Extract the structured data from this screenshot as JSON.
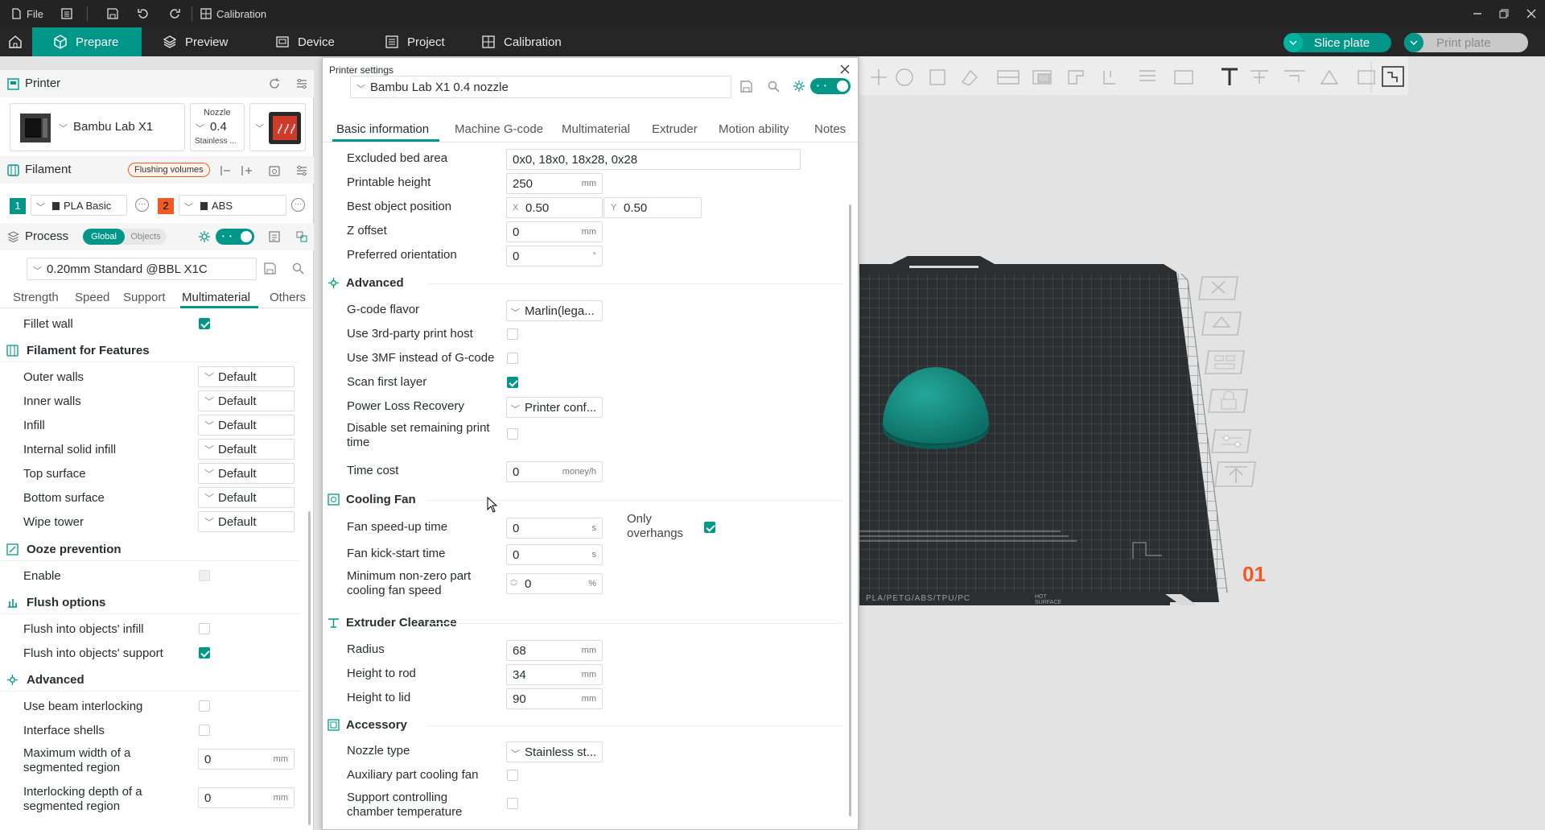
{
  "titlebar": {
    "file_label": "File",
    "window_title": "Calibration",
    "icons": [
      "file-icon",
      "menu-list-icon",
      "save-icon",
      "undo-icon",
      "redo-icon",
      "calibration-icon",
      "minimize-icon",
      "restore-icon",
      "close-icon"
    ]
  },
  "menubar": {
    "tabs": [
      {
        "label": "Prepare",
        "icon": "cube-icon",
        "active": true
      },
      {
        "label": "Preview",
        "icon": "layers-icon"
      },
      {
        "label": "Device",
        "icon": "device-icon"
      },
      {
        "label": "Project",
        "icon": "project-icon"
      },
      {
        "label": "Calibration",
        "icon": "calibration-icon"
      }
    ],
    "slice_label": "Slice plate",
    "print_label": "Print plate"
  },
  "left": {
    "printer": {
      "title": "Printer",
      "name": "Bambu Lab X1",
      "nozzle_label": "Nozzle",
      "nozzle_value": "0.4",
      "nozzle_material": "Stainless ..."
    },
    "filament": {
      "title": "Filament",
      "flushing_label": "Flushing volumes",
      "items": [
        {
          "index": "1",
          "name": "PLA Basic",
          "color": "#009688"
        },
        {
          "index": "2",
          "name": "ABS",
          "color": "#f05a23"
        }
      ]
    },
    "process": {
      "title": "Process",
      "global_label": "Global",
      "objects_label": "Objects",
      "preset": "0.20mm Standard @BBL X1C",
      "tabs": [
        "Strength",
        "Speed",
        "Support",
        "Multimaterial",
        "Others"
      ],
      "active_tab": "Multimaterial"
    },
    "settings": {
      "fillet_wall": "Fillet wall",
      "filament_features": {
        "title": "Filament for Features",
        "rows": [
          {
            "label": "Outer walls",
            "value": "Default"
          },
          {
            "label": "Inner walls",
            "value": "Default"
          },
          {
            "label": "Infill",
            "value": "Default"
          },
          {
            "label": "Internal solid infill",
            "value": "Default"
          },
          {
            "label": "Top surface",
            "value": "Default"
          },
          {
            "label": "Bottom surface",
            "value": "Default"
          },
          {
            "label": "Wipe tower",
            "value": "Default"
          }
        ]
      },
      "ooze": {
        "title": "Ooze prevention",
        "enable": "Enable"
      },
      "flush": {
        "title": "Flush options",
        "infill": "Flush into objects' infill",
        "support": "Flush into objects' support"
      },
      "advanced": {
        "title": "Advanced",
        "beam": "Use beam interlocking",
        "shells": "Interface shells",
        "max_width_1": "Maximum width of a",
        "max_width_2": "segmented region",
        "max_width_value": "0",
        "depth_1": "Interlocking depth of a",
        "depth_2": "segmented region",
        "depth_value": "0",
        "unit": "mm"
      }
    }
  },
  "dialog": {
    "title": "Printer settings",
    "preset": "Bambu Lab X1 0.4 nozzle",
    "tabs": [
      "Basic information",
      "Machine G-code",
      "Multimaterial",
      "Extruder",
      "Motion ability",
      "Notes"
    ],
    "active_tab": "Basic information",
    "basic": {
      "excluded_bed_area": {
        "label": "Excluded bed area",
        "value": "0x0, 18x0, 18x28, 0x28"
      },
      "printable_height": {
        "label": "Printable height",
        "value": "250",
        "unit": "mm"
      },
      "best_object_position": {
        "label": "Best object position",
        "x_label": "X",
        "x": "0.50",
        "y_label": "Y",
        "y": "0.50"
      },
      "z_offset": {
        "label": "Z offset",
        "value": "0",
        "unit": "mm"
      },
      "preferred_orientation": {
        "label": "Preferred orientation",
        "value": "0",
        "unit": "°"
      }
    },
    "advanced": {
      "title": "Advanced",
      "gcode_flavor": {
        "label": "G-code flavor",
        "value": "Marlin(lega..."
      },
      "third_party": "Use 3rd-party print host",
      "use_3mf": "Use 3MF instead of G-code",
      "scan_first_layer": "Scan first layer",
      "power_loss": {
        "label": "Power Loss Recovery",
        "value": "Printer conf..."
      },
      "disable_remaining_1": "Disable set remaining print",
      "disable_remaining_2": "time",
      "time_cost": {
        "label": "Time cost",
        "value": "0",
        "unit": "money/h"
      }
    },
    "cooling": {
      "title": "Cooling Fan",
      "speedup": {
        "label": "Fan speed-up time",
        "value": "0",
        "unit": "s"
      },
      "only_overhangs_1": "Only",
      "only_overhangs_2": "overhangs",
      "kickstart": {
        "label": "Fan kick-start time",
        "value": "0",
        "unit": "s"
      },
      "min_speed_1": "Minimum non-zero part",
      "min_speed_2": "cooling fan speed",
      "min_speed_value": "0",
      "min_speed_unit": "%"
    },
    "clearance": {
      "title": "Extruder Clearance",
      "radius": {
        "label": "Radius",
        "value": "68",
        "unit": "mm"
      },
      "height_rod": {
        "label": "Height to rod",
        "value": "34",
        "unit": "mm"
      },
      "height_lid": {
        "label": "Height to lid",
        "value": "90",
        "unit": "mm"
      }
    },
    "accessory": {
      "title": "Accessory",
      "nozzle_type": {
        "label": "Nozzle type",
        "value": "Stainless st..."
      },
      "aux_fan": "Auxiliary part cooling fan",
      "chamber_1": "Support controlling",
      "chamber_2": "chamber temperature"
    }
  },
  "viewport": {
    "plate_number": "01",
    "plate_label": "PLA/PETG/ABS/TPU/PC",
    "hot_surface": "HOT SURFACE"
  },
  "colors": {
    "accent": "#009688",
    "filament_2": "#f05a23",
    "model": "#0f857a",
    "plate_number": "#f05a23"
  }
}
